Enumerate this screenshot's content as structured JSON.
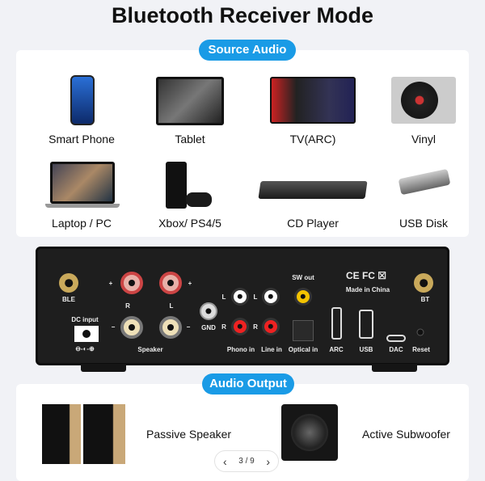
{
  "title": "Bluetooth Receiver Mode",
  "source_audio": {
    "label": "Source Audio",
    "items": [
      {
        "label": "Smart Phone",
        "icon": "smartphone-image"
      },
      {
        "label": "Tablet",
        "icon": "tablet-image"
      },
      {
        "label": "TV(ARC)",
        "icon": "tv-image"
      },
      {
        "label": "Vinyl",
        "icon": "turntable-image"
      },
      {
        "label": "Laptop / PC",
        "icon": "laptop-image"
      },
      {
        "label": "Xbox/ PS4/5",
        "icon": "console-image"
      },
      {
        "label": "CD Player",
        "icon": "cd-player-image"
      },
      {
        "label": "USB Disk",
        "icon": "usb-disk-image"
      }
    ]
  },
  "panel": {
    "ble": "BLE",
    "bt": "BT",
    "plus": "+",
    "minus": "−",
    "r": "R",
    "l": "L",
    "speaker": "Speaker",
    "dc_input": "DC input",
    "dc_symbol": "⊖-◐-⊕",
    "gnd": "GND",
    "phono_in": "Phono in",
    "line_in": "Line in",
    "sw_out": "SW out",
    "optical_in": "Optical in",
    "certs": "CE FC ☒",
    "made_in": "Made in China",
    "arc": "ARC",
    "usb": "USB",
    "dac": "DAC",
    "reset": "Reset"
  },
  "audio_output": {
    "label": "Audio Output",
    "items": [
      {
        "label": "Passive Speaker",
        "icon": "passive-speaker-image"
      },
      {
        "label": "Active Subwoofer",
        "icon": "subwoofer-image"
      }
    ]
  },
  "pager": {
    "prev": "‹",
    "text": "3 / 9",
    "next": "›"
  },
  "colors": {
    "accent": "#1a9be6",
    "background": "#f1f2f6"
  }
}
